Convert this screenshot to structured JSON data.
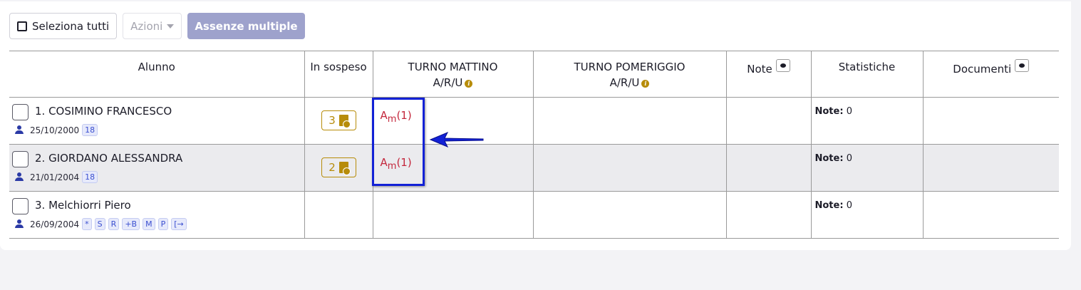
{
  "toolbar": {
    "select_all_label": "Seleziona tutti",
    "actions_label": "Azioni",
    "multiple_absences_label": "Assenze multiple"
  },
  "table": {
    "headers": {
      "student": "Alunno",
      "pending": "In sospeso",
      "morning": "TURNO MATTINO",
      "morning_sub": "A/R/U",
      "afternoon": "TURNO POMERIGGIO",
      "afternoon_sub": "A/R/U",
      "notes": "Note",
      "stats": "Statistiche",
      "documents": "Documenti"
    },
    "rows": [
      {
        "name": "1. COSIMINO FRANCESCO",
        "birthdate": "25/10/2000",
        "tags": [
          "18"
        ],
        "pending_count": "3",
        "absence_letter": "A",
        "absence_sub": "m",
        "absence_count": "(1)",
        "stats_label": "Note:",
        "stats_value": "0"
      },
      {
        "name": "2. GIORDANO ALESSANDRA",
        "birthdate": "21/01/2004",
        "tags": [
          "18"
        ],
        "pending_count": "2",
        "absence_letter": "A",
        "absence_sub": "m",
        "absence_count": "(1)",
        "stats_label": "Note:",
        "stats_value": "0"
      },
      {
        "name": "3. Melchiorri Piero",
        "birthdate": "26/09/2004",
        "tags": [
          "*",
          "S",
          "R",
          "+B",
          "M",
          "P",
          "[→"
        ],
        "stats_label": "Note:",
        "stats_value": "0"
      }
    ]
  },
  "icons": {
    "info": "info-icon",
    "eye": "eye-icon",
    "person": "person-icon",
    "pending_doc": "document-warning-icon",
    "exit": "exit-icon"
  },
  "colors": {
    "accent": "#9ea2cc",
    "pending": "#b78c09",
    "absence": "#c4283d",
    "highlight": "#1221d6"
  }
}
